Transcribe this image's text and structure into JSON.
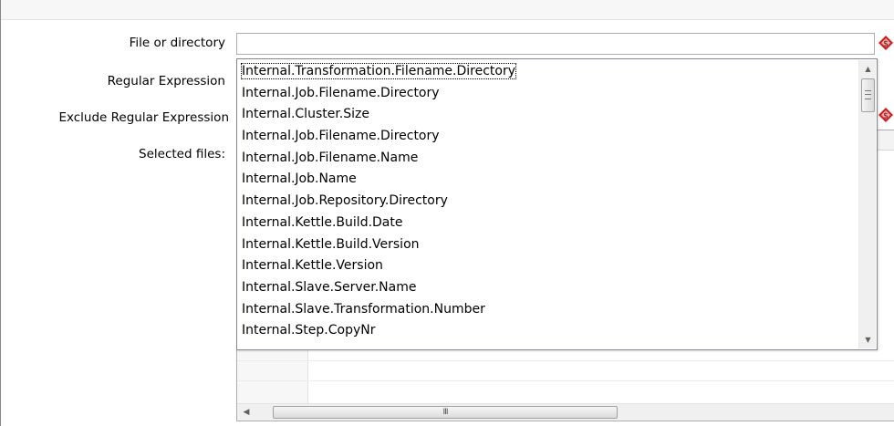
{
  "form": {
    "file_label": "File or directory",
    "file_value": "",
    "regex_label": "Regular Expression",
    "exclude_label": "Exclude Regular Expression",
    "selected_label": "Selected files:"
  },
  "variable_icon": {
    "name": "variable-insert-icon",
    "color_primary": "#cc2020",
    "color_secondary": "#e8b0b0"
  },
  "popup": {
    "items": [
      "Internal.Transformation.Filename.Directory",
      "Internal.Job.Filename.Directory",
      "Internal.Cluster.Size",
      "Internal.Job.Filename.Directory",
      "Internal.Job.Filename.Name",
      "Internal.Job.Name",
      "Internal.Job.Repository.Directory",
      "Internal.Kettle.Build.Date",
      "Internal.Kettle.Build.Version",
      "Internal.Kettle.Version",
      "Internal.Slave.Server.Name",
      "Internal.Slave.Transformation.Number",
      "Internal.Step.CopyNr"
    ],
    "selected_index": 0,
    "scroll_up_icon": "▲",
    "scroll_down_icon": "▼"
  },
  "grid": {
    "hscroll_left_icon": "◀",
    "hscroll_grip": "III"
  }
}
